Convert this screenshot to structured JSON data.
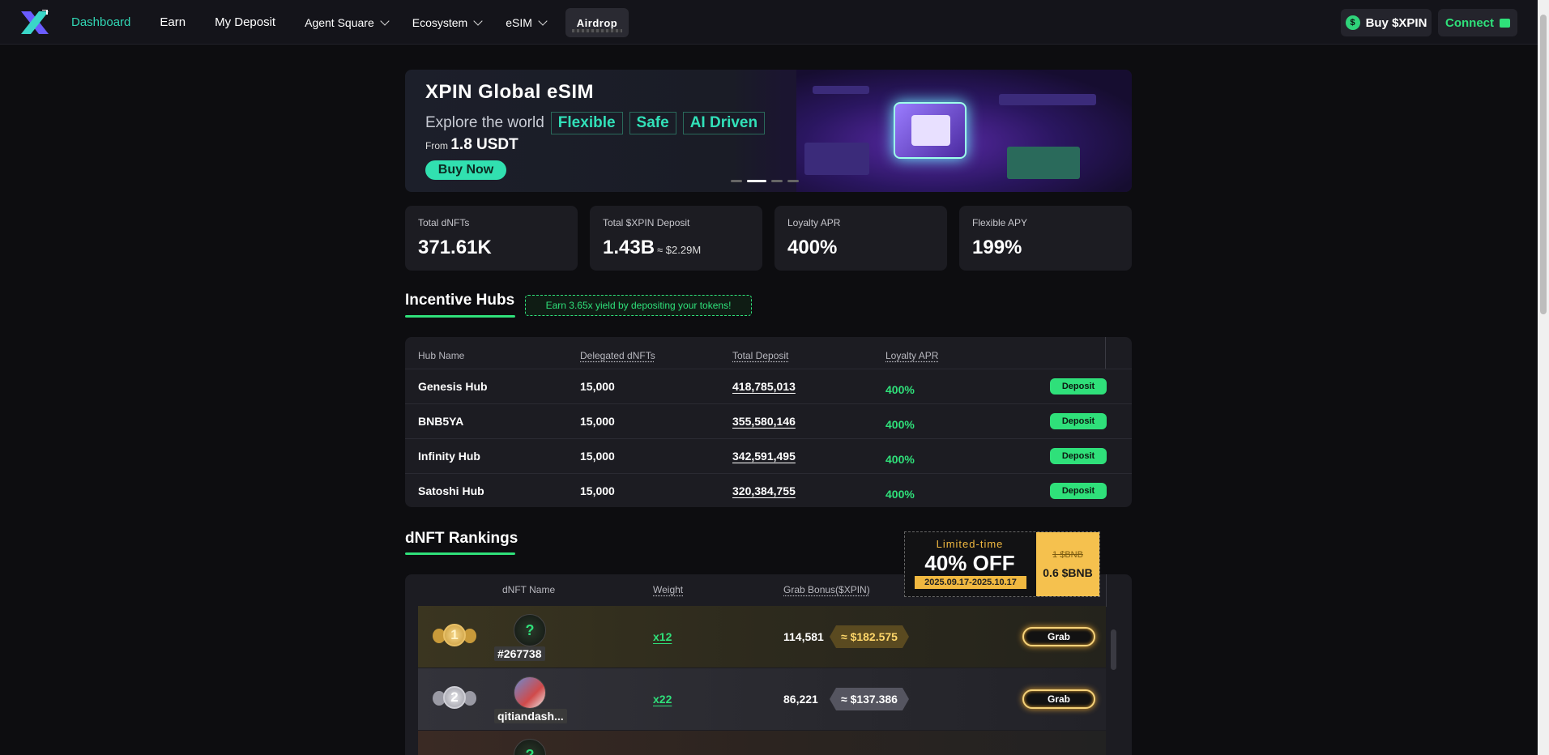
{
  "nav": {
    "items": [
      {
        "label": "Dashboard",
        "active": true,
        "dropdown": false
      },
      {
        "label": "Earn",
        "active": false,
        "dropdown": false
      },
      {
        "label": "My Deposit",
        "active": false,
        "dropdown": false
      },
      {
        "label": "Agent Square",
        "active": false,
        "dropdown": true
      },
      {
        "label": "Ecosystem",
        "active": false,
        "dropdown": true
      },
      {
        "label": "eSIM",
        "active": false,
        "dropdown": true
      }
    ],
    "airdrop_label": "Airdrop",
    "buy_label": "Buy $XPIN",
    "connect_label": "Connect"
  },
  "banner": {
    "title": "XPIN Global eSIM",
    "subtitle": "Explore the world",
    "tags": [
      "Flexible",
      "Safe",
      "AI Driven"
    ],
    "price_prefix": "From",
    "price": "1.8 USDT",
    "cta": "Buy Now",
    "active_slide": 2,
    "slide_count": 4
  },
  "stats": [
    {
      "label": "Total dNFTs",
      "value": "371.61K",
      "sub": ""
    },
    {
      "label": "Total $XPIN Deposit",
      "value": "1.43B",
      "sub": "≈ $2.29M"
    },
    {
      "label": "Loyalty APR",
      "value": "400%",
      "sub": ""
    },
    {
      "label": "Flexible APY",
      "value": "199%",
      "sub": ""
    }
  ],
  "incentive": {
    "title": "Incentive Hubs",
    "tag": "Earn 3.65x yield by depositing your tokens!",
    "columns": [
      "Hub Name",
      "Delegated dNFTs",
      "Total Deposit",
      "Loyalty APR"
    ],
    "rows": [
      {
        "name": "Genesis Hub",
        "dnfts": "15,000",
        "deposit": "418,785,013",
        "apr": "400%",
        "action": "Deposit"
      },
      {
        "name": "BNB5YA",
        "dnfts": "15,000",
        "deposit": "355,580,146",
        "apr": "400%",
        "action": "Deposit"
      },
      {
        "name": "Infinity Hub",
        "dnfts": "15,000",
        "deposit": "342,591,495",
        "apr": "400%",
        "action": "Deposit"
      },
      {
        "name": "Satoshi Hub",
        "dnfts": "15,000",
        "deposit": "320,384,755",
        "apr": "400%",
        "action": "Deposit"
      }
    ]
  },
  "rankings": {
    "title": "dNFT Rankings",
    "columns": [
      "dNFT Name",
      "Weight",
      "Grab Bonus($XPIN)"
    ],
    "rows": [
      {
        "rank": "1",
        "name": "#267738",
        "weight": "x12",
        "bonus": "114,581",
        "usd": "≈ $182.575",
        "action": "Grab"
      },
      {
        "rank": "2",
        "name": "qitiandash...",
        "weight": "x22",
        "bonus": "86,221",
        "usd": "≈ $137.386",
        "action": "Grab"
      }
    ]
  },
  "promo": {
    "limited": "Limited-time",
    "discount": "40% OFF",
    "dates": "2025.09.17-2025.10.17",
    "old_price": "1 $BNB",
    "new_price": "0.6 $BNB"
  },
  "colors": {
    "accent": "#2fe07a",
    "teal": "#31d6b4",
    "background": "#0d0d10",
    "card": "#1c1c22",
    "promo_gold": "#f5c14e"
  }
}
